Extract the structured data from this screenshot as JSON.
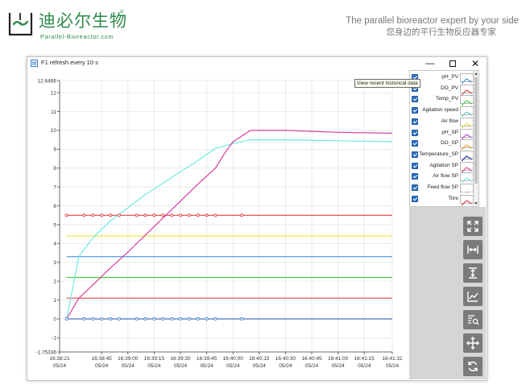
{
  "brand": {
    "name_cn": "迪必尔生物",
    "registered": "®",
    "name_en": "Parallel-Bioreactor.com",
    "slogan_en": "The parallel bioreactor expert  by your side",
    "slogan_cn": "您身边的平行生物反应器专家",
    "color": "#2c8a4b"
  },
  "window": {
    "title": "F1 refresh every 10 s",
    "minimize_glyph": "—",
    "close_glyph": "✕"
  },
  "tooltip": "View recent historical data",
  "legend": {
    "items": [
      {
        "label": "pH_PV",
        "checked": true,
        "color": "#4a90d9"
      },
      {
        "label": "DO_PV",
        "checked": true,
        "color": "#e04343"
      },
      {
        "label": "Temp_PV",
        "checked": true,
        "color": "#44cc44"
      },
      {
        "label": "Agitation speed",
        "checked": true,
        "color": "#5fc6c6"
      },
      {
        "label": "Air flow",
        "checked": true,
        "color": "#e6e64c"
      },
      {
        "label": "pH_SP",
        "checked": true,
        "color": "#b04fd6"
      },
      {
        "label": "DO_SP",
        "checked": true,
        "color": "#e2a020"
      },
      {
        "label": "Temperature_SP",
        "checked": true,
        "color": "#1a2e9e"
      },
      {
        "label": "Agitation SP",
        "checked": true,
        "color": "#d63fa0"
      },
      {
        "label": "Air flow SP",
        "checked": true,
        "color": "#6ee8e8"
      },
      {
        "label": "Feed flow SP",
        "checked": true,
        "color": "#ffffff"
      },
      {
        "label": "Titre",
        "checked": true,
        "color": "#e04343"
      }
    ]
  },
  "toolbar": {
    "buttons": [
      {
        "name": "fit-screen-button",
        "icon": "fit-screen-icon"
      },
      {
        "name": "zoom-x-button",
        "icon": "horizontal-zoom-icon"
      },
      {
        "name": "zoom-y-button",
        "icon": "vertical-zoom-icon"
      },
      {
        "name": "chart-mode-button",
        "icon": "line-chart-icon"
      },
      {
        "name": "data-search-button",
        "icon": "data-search-icon"
      },
      {
        "name": "pan-button",
        "icon": "move-icon"
      },
      {
        "name": "refresh-button",
        "icon": "refresh-icon"
      }
    ]
  },
  "chart_data": {
    "type": "line",
    "title": "",
    "xlabel": "",
    "ylabel": "",
    "grid": true,
    "legend_position": "right",
    "xlim": [
      "16:38:21",
      "16:41:31"
    ],
    "ylim": [
      -1.75336,
      12.6466
    ],
    "x_ticks": [
      {
        "time": "16:38:21",
        "date": "05/24"
      },
      {
        "time": "16:38:45",
        "date": "05/24"
      },
      {
        "time": "16:39:00",
        "date": "05/24"
      },
      {
        "time": "16:39:15",
        "date": "05/24"
      },
      {
        "time": "16:39:30",
        "date": "05/24"
      },
      {
        "time": "16:39:45",
        "date": "05/24"
      },
      {
        "time": "16:40:00",
        "date": "05/24"
      },
      {
        "time": "16:40:15",
        "date": "05/24"
      },
      {
        "time": "16:40:30",
        "date": "05/24"
      },
      {
        "time": "16:40:45",
        "date": "05/24"
      },
      {
        "time": "16:41:00",
        "date": "05/24"
      },
      {
        "time": "16:41:15",
        "date": "05/24"
      },
      {
        "time": "16:41:31",
        "date": "05/24"
      }
    ],
    "y_ticks": [
      "12.6466",
      "12",
      "11",
      "10",
      "9",
      "8",
      "7",
      "6",
      "5",
      "4",
      "3",
      "2",
      "1",
      "0",
      "-1",
      "-1.75336"
    ],
    "series": [
      {
        "color": "#e04343",
        "points": [
          [
            "16:38:25",
            0
          ],
          [
            "16:41:31",
            0
          ]
        ]
      },
      {
        "color": "#4a90d9",
        "points": [
          [
            "16:38:25",
            0
          ],
          [
            "16:41:31",
            0
          ]
        ]
      },
      {
        "color": "#e04343",
        "points": [
          [
            "16:38:25",
            1.1
          ],
          [
            "16:41:31",
            1.1
          ]
        ]
      },
      {
        "color": "#44cc44",
        "points": [
          [
            "16:38:25",
            2.2
          ],
          [
            "16:41:31",
            2.2
          ]
        ]
      },
      {
        "color": "#4a90d9",
        "points": [
          [
            "16:38:25",
            3.3
          ],
          [
            "16:41:31",
            3.3
          ]
        ]
      },
      {
        "color": "#e6e64c",
        "points": [
          [
            "16:38:25",
            4.4
          ],
          [
            "16:41:31",
            4.4
          ]
        ]
      },
      {
        "color": "#e04343",
        "points": [
          [
            "16:38:25",
            5.5
          ],
          [
            "16:41:31",
            5.5
          ]
        ]
      },
      {
        "color": "#6ee8e8",
        "points": [
          [
            "16:38:25",
            0
          ],
          [
            "16:38:32",
            3.3
          ],
          [
            "16:38:40",
            4.3
          ],
          [
            "16:38:50",
            5.2
          ],
          [
            "16:39:00",
            5.9
          ],
          [
            "16:39:10",
            6.6
          ],
          [
            "16:39:20",
            7.2
          ],
          [
            "16:39:30",
            7.8
          ],
          [
            "16:39:40",
            8.4
          ],
          [
            "16:39:50",
            9.05
          ],
          [
            "16:40:00",
            9.3
          ],
          [
            "16:40:10",
            9.5
          ],
          [
            "16:40:30",
            9.5
          ],
          [
            "16:41:00",
            9.45
          ],
          [
            "16:41:31",
            9.4
          ]
        ]
      },
      {
        "color": "#d63fa0",
        "points": [
          [
            "16:38:25",
            0
          ],
          [
            "16:38:32",
            1.1
          ],
          [
            "16:38:40",
            1.8
          ],
          [
            "16:38:50",
            2.7
          ],
          [
            "16:39:00",
            3.55
          ],
          [
            "16:39:10",
            4.45
          ],
          [
            "16:39:20",
            5.35
          ],
          [
            "16:39:30",
            6.25
          ],
          [
            "16:39:40",
            7.15
          ],
          [
            "16:39:50",
            8.0
          ],
          [
            "16:39:55",
            8.75
          ],
          [
            "16:40:00",
            9.4
          ],
          [
            "16:40:10",
            10.0
          ],
          [
            "16:40:30",
            10.0
          ],
          [
            "16:41:00",
            9.9
          ],
          [
            "16:41:31",
            9.85
          ]
        ]
      }
    ],
    "markers": [
      {
        "color": "#e04343",
        "y": 5.5,
        "times": [
          "16:38:25",
          "16:38:35",
          "16:38:40",
          "16:38:45",
          "16:38:50",
          "16:38:55",
          "16:39:05",
          "16:39:10",
          "16:39:15",
          "16:39:20",
          "16:39:25",
          "16:39:30",
          "16:39:35",
          "16:39:40",
          "16:39:45",
          "16:39:50",
          "16:40:05"
        ]
      },
      {
        "color": "#4a90d9",
        "y": 0,
        "times": [
          "16:38:25",
          "16:38:35",
          "16:38:40",
          "16:38:45",
          "16:38:50",
          "16:38:55",
          "16:39:05",
          "16:39:10",
          "16:39:15",
          "16:39:20",
          "16:39:25",
          "16:39:30",
          "16:39:35",
          "16:39:40",
          "16:39:45",
          "16:39:50",
          "16:40:05"
        ]
      }
    ]
  }
}
